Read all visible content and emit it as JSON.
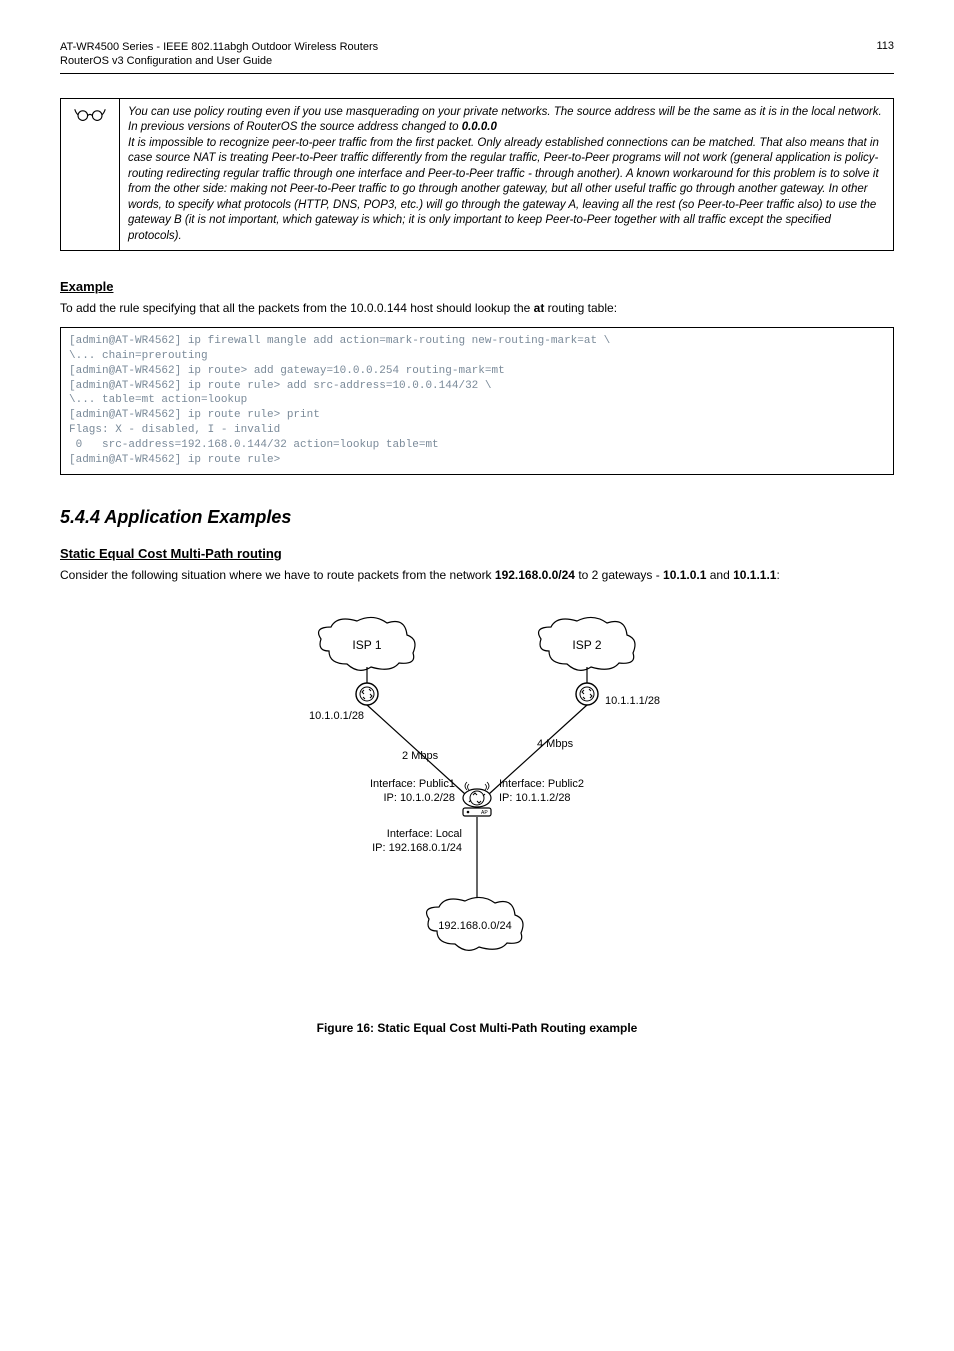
{
  "header": {
    "line1": "AT-WR4500 Series - IEEE 802.11abgh Outdoor Wireless Routers",
    "line2": "RouterOS v3 Configuration and User Guide",
    "page": "113"
  },
  "note": {
    "para1_a": "You can use policy routing even if you use masquerading on your private networks. The source address will be the same as it is in the local network. In previous versions of RouterOS the source address changed to ",
    "para1_b_bold": "0.0.0.0",
    "para2": "It is impossible to recognize peer-to-peer traffic from the first packet. Only already established connections can be matched. That also means that in case source NAT is treating Peer-to-Peer traffic differently from the regular traffic, Peer-to-Peer programs will not work (general application is policy-routing redirecting regular traffic through one interface and Peer-to-Peer traffic - through another). A known workaround for this problem is to solve it from the other side: making not Peer-to-Peer traffic to go through another gateway, but all other useful traffic go through another gateway. In other words, to specify what protocols (HTTP, DNS, POP3, etc.) will go through the gateway A, leaving all the rest (so Peer-to-Peer traffic also) to use the gateway B (it is not important, which gateway is which; it is only important to keep Peer-to-Peer together with all traffic except the specified protocols)."
  },
  "example": {
    "heading": "Example",
    "intro_a": "To add the rule specifying that all the packets from the 10.0.0.144 host should lookup the ",
    "intro_bold": "at",
    "intro_b": " routing table:",
    "code": "[admin@AT-WR4562] ip firewall mangle add action=mark-routing new-routing-mark=at \\\n\\... chain=prerouting\n[admin@AT-WR4562] ip route> add gateway=10.0.0.254 routing-mark=mt\n[admin@AT-WR4562] ip route rule> add src-address=10.0.0.144/32 \\\n\\... table=mt action=lookup\n[admin@AT-WR4562] ip route rule> print\nFlags: X - disabled, I - invalid\n 0   src-address=192.168.0.144/32 action=lookup table=mt\n[admin@AT-WR4562] ip route rule>"
  },
  "app_examples": {
    "heading": "5.4.4  Application Examples",
    "subheading": "Static Equal Cost Multi-Path routing",
    "intro_a": "Consider the following situation where we have to route packets from the network ",
    "intro_b1": "192.168.0.0/24",
    "intro_c": " to 2 gateways - ",
    "intro_b2": "10.1.0.1",
    "intro_d": " and ",
    "intro_b3": "10.1.1.1",
    "intro_e": ":",
    "caption": "Figure 16: Static Equal Cost Multi-Path Routing example"
  },
  "diagram": {
    "isp1": "ISP 1",
    "isp2": "ISP 2",
    "ip_left": "10.1.0.1/28",
    "ip_right": "10.1.1.1/28",
    "rate_left": "2 Mbps",
    "rate_right": "4 Mbps",
    "if_pub1_a": "Interface: Public1",
    "if_pub1_b": "IP: 10.1.0.2/28",
    "if_pub2_a": "Interface: Public2",
    "if_pub2_b": "IP: 10.1.1.2/28",
    "if_local_a": "Interface: Local",
    "if_local_b": "IP: 192.168.0.1/24",
    "bottom_net": "192.168.0.0/24"
  }
}
